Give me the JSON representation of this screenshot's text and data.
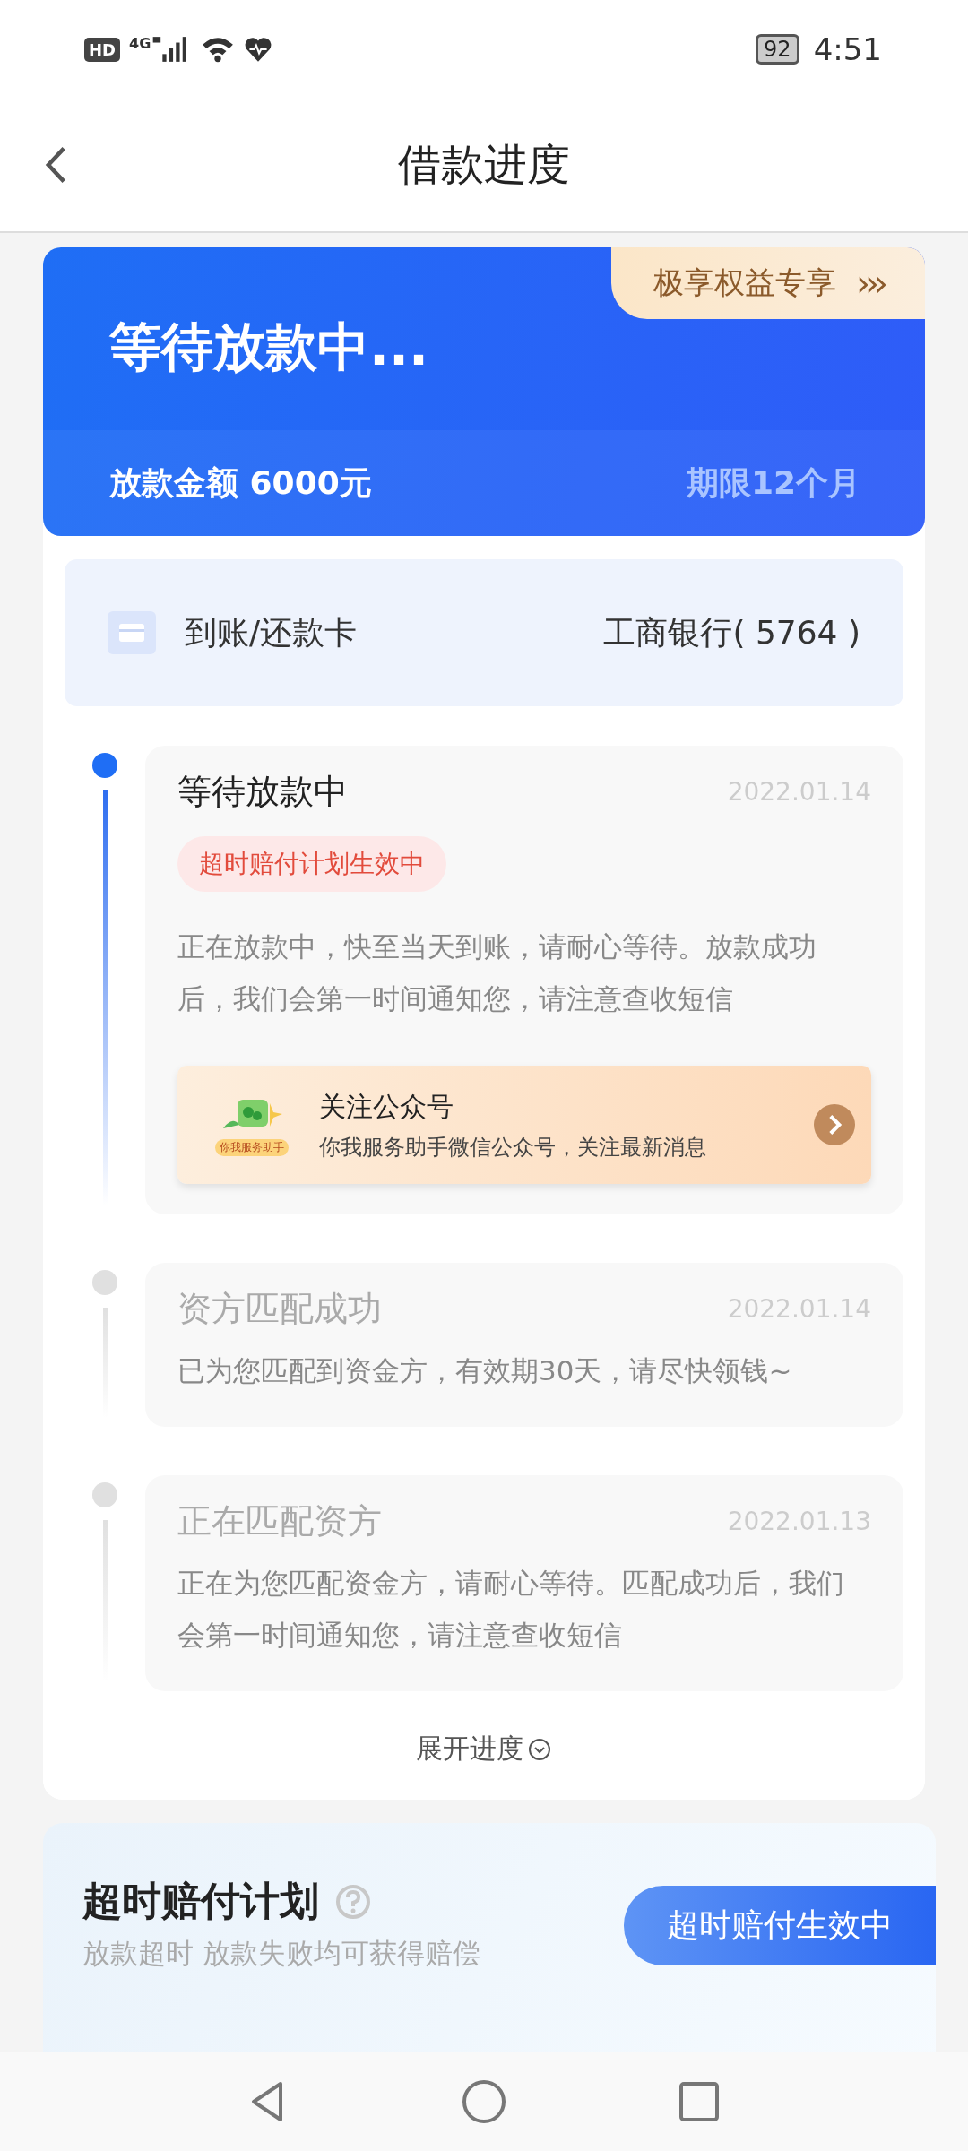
{
  "status_bar": {
    "hd": "HD",
    "network": "4G",
    "battery": "92",
    "time": "4:51"
  },
  "nav": {
    "title": "借款进度"
  },
  "summary": {
    "status": "等待放款中...",
    "perk": "极享权益专享",
    "perk_arrows": "›››",
    "amount": "放款金额 6000元",
    "term": "期限12个月"
  },
  "card": {
    "label": "到账/还款卡",
    "bank": "工商银行( 5764 )"
  },
  "timeline": [
    {
      "title": "等待放款中",
      "date": "2022.01.14",
      "active": true,
      "tag": "超时赔付计划生效中",
      "desc": "正在放款中，快至当天到账，请耐心等待。放款成功后，我们会第一时间通知您，请注意查收短信",
      "promo": {
        "badge": "你我服务助手",
        "title": "关注公众号",
        "subtitle": "你我服务助手微信公众号，关注最新消息"
      }
    },
    {
      "title": "资方匹配成功",
      "date": "2022.01.14",
      "active": false,
      "desc": "已为您匹配到资金方，有效期30天，请尽快领钱~"
    },
    {
      "title": "正在匹配资方",
      "date": "2022.01.13",
      "active": false,
      "desc": "正在为您匹配资金方，请耐心等待。匹配成功后，我们会第一时间通知您，请注意查收短信"
    }
  ],
  "expand": {
    "label": "展开进度"
  },
  "compensation": {
    "title": "超时赔付计划",
    "subtitle": "放款超时 放款失败均可获得赔偿",
    "button": "超时赔付生效中"
  }
}
